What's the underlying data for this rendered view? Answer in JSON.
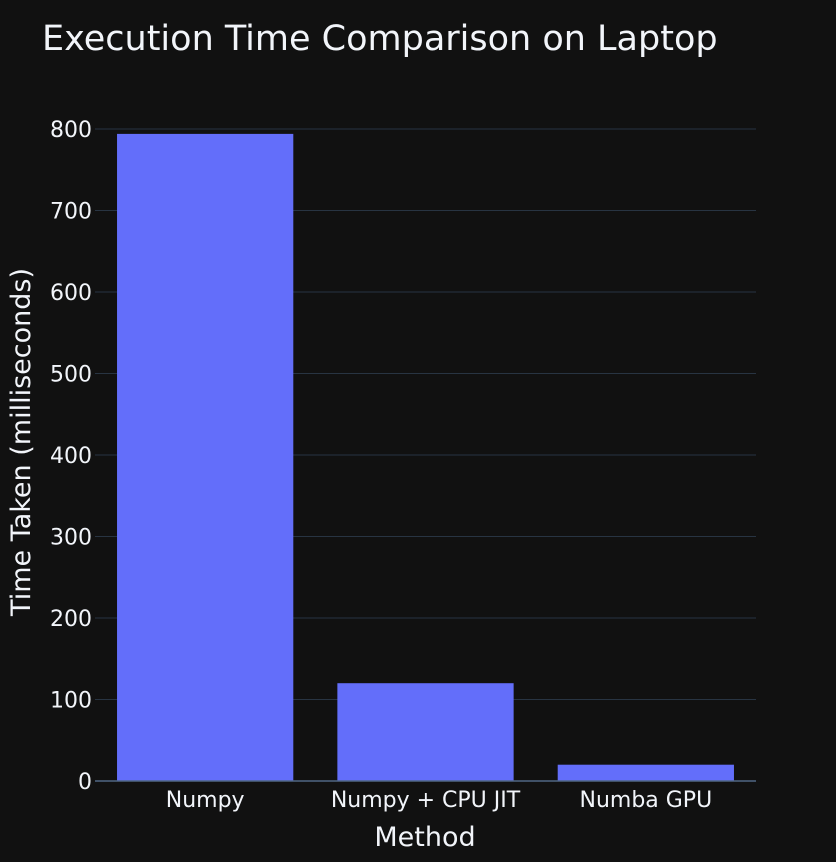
{
  "chart_data": {
    "type": "bar",
    "title": "Execution Time Comparison on Laptop",
    "xlabel": "Method",
    "ylabel": "Time Taken (milliseconds)",
    "categories": [
      "Numpy",
      "Numpy + CPU JIT",
      "Numba GPU"
    ],
    "values": [
      794,
      120,
      20
    ],
    "ylim": [
      0,
      800
    ],
    "yticks": [
      0,
      100,
      200,
      300,
      400,
      500,
      600,
      700,
      800
    ],
    "grid": true,
    "colors": {
      "bar": "#636efa",
      "background": "#111111",
      "text": "#f2f5fa",
      "grid": "#283442"
    }
  }
}
